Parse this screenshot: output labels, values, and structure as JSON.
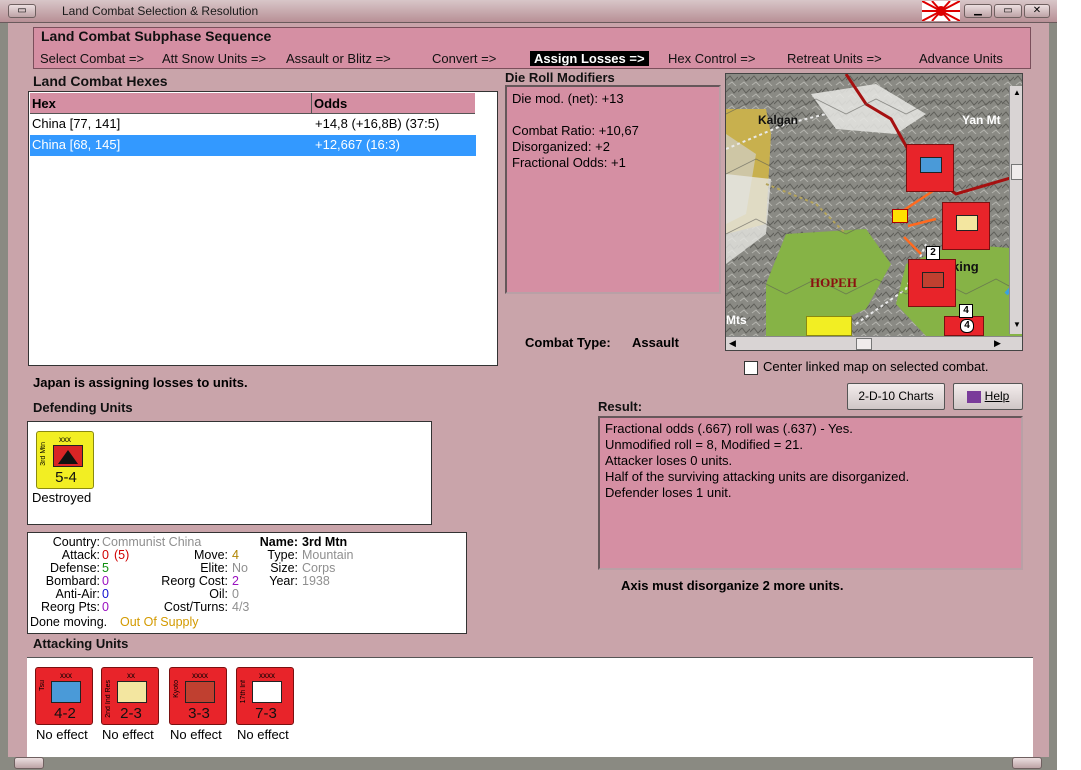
{
  "window": {
    "title": "Land Combat Selection & Resolution"
  },
  "sequence": {
    "title": "Land Combat Subphase Sequence",
    "steps": [
      "Select Combat =>",
      "Att Snow Units =>",
      "Assault or Blitz =>",
      "Convert =>",
      "Assign Losses =>",
      "Hex Control =>",
      "Retreat Units =>",
      "Advance Units"
    ],
    "active_index": 4
  },
  "hexes": {
    "title": "Land Combat Hexes",
    "columns": [
      "Hex",
      "Odds"
    ],
    "rows": [
      {
        "hex": "China [77, 141]",
        "odds": "+14,8 (+16,8B) (37:5)"
      },
      {
        "hex": "China [68, 145]",
        "odds": "+12,667 (16:3)"
      }
    ],
    "selected_index": 1
  },
  "modifiers": {
    "title": "Die Roll Modifiers",
    "lines": [
      "Die mod. (net): +13",
      "",
      "Combat Ratio: +10,67",
      "Disorganized: +2",
      "Fractional Odds: +1"
    ]
  },
  "map": {
    "labels": {
      "kalgan": "Kalgan",
      "yanmt": "Yan Mt",
      "hopeh": "HOPEH",
      "king": "king",
      "mts": "Mts"
    },
    "stack_counts": [
      "2",
      "4",
      "4"
    ]
  },
  "combat_type": {
    "label": "Combat Type:",
    "value": "Assault"
  },
  "center_map": {
    "label": "Center linked map on selected combat.",
    "checked": false
  },
  "status": "Japan is assigning losses to units.",
  "defending": {
    "title": "Defending Units",
    "units": [
      {
        "size": "xxx",
        "name": "3rd Mtn",
        "strength": "5-4",
        "status": "Destroyed"
      }
    ]
  },
  "details": {
    "country_label": "Country:",
    "country": "Communist China",
    "attack_label": "Attack:",
    "attack": "0",
    "attack_base": "(5)",
    "defense_label": "Defense:",
    "defense": "5",
    "bombard_label": "Bombard:",
    "bombard": "0",
    "antiair_label": "Anti-Air:",
    "antiair": "0",
    "reorgpts_label": "Reorg Pts:",
    "reorgpts": "0",
    "move_label": "Move:",
    "move": "4",
    "elite_label": "Elite:",
    "elite": "No",
    "reorgcost_label": "Reorg Cost:",
    "reorgcost": "2",
    "oil_label": "Oil:",
    "oil": "0",
    "costturns_label": "Cost/Turns:",
    "costturns": "4/3",
    "name_label": "Name:",
    "name": "3rd Mtn",
    "type_label": "Type:",
    "type": "Mountain",
    "size_label": "Size:",
    "size": "Corps",
    "year_label": "Year:",
    "year": "1938",
    "done_text": "Done moving.",
    "supply_text": "Out Of Supply"
  },
  "buttons": {
    "charts": "2-D-10 Charts",
    "help": "Help"
  },
  "result": {
    "title": "Result:",
    "lines": [
      "Fractional odds (.667) roll was (.637)  - Yes.",
      "Unmodified roll = 8, Modified = 21.",
      "Attacker loses 0 units.",
      "Half of the surviving attacking units are disorganized.",
      "Defender loses 1 unit."
    ]
  },
  "axis_message": "Axis must disorganize 2 more units.",
  "attacking": {
    "title": "Attacking Units",
    "units": [
      {
        "size": "xxx",
        "side": "Tsu",
        "strength": "4-2",
        "status": "No effect"
      },
      {
        "size": "xx",
        "side": "2nd Ind Res",
        "strength": "2-3",
        "status": "No effect"
      },
      {
        "size": "xxxx",
        "side": "Kyoto",
        "strength": "3-3",
        "status": "No effect"
      },
      {
        "size": "xxxx",
        "side": "17th Inf",
        "strength": "7-3",
        "status": "No effect"
      }
    ]
  },
  "colors": {
    "panel_pink": "#d58fa3",
    "frame_pink": "#c9a4aa",
    "unit_red": "#e8242a",
    "unit_yellow": "#f2ee23",
    "selection_blue": "#3399ff"
  }
}
